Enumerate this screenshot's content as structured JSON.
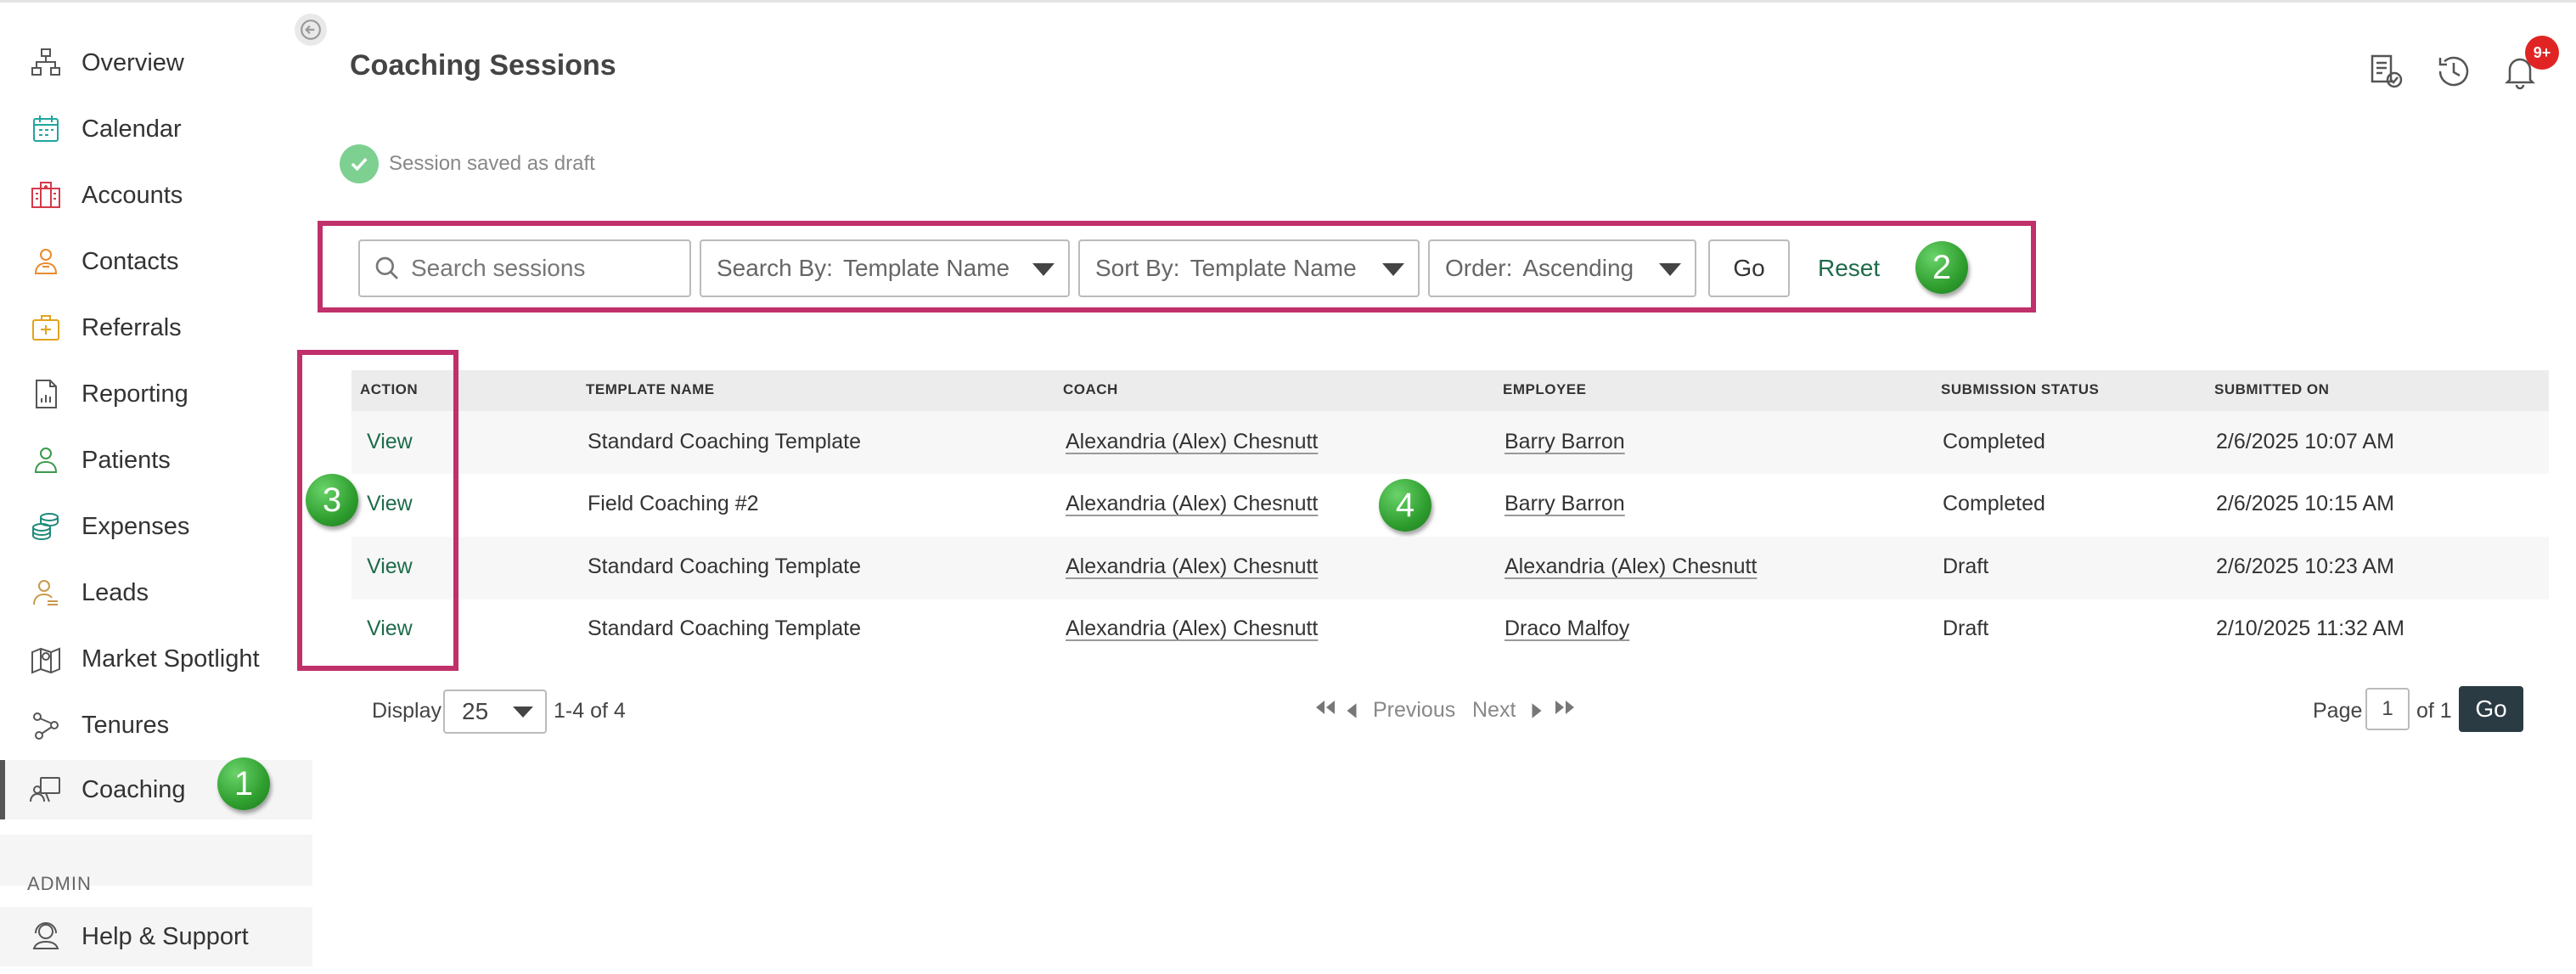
{
  "sidebar": {
    "items": [
      {
        "label": "Overview",
        "icon": "overview-icon"
      },
      {
        "label": "Calendar",
        "icon": "calendar-icon"
      },
      {
        "label": "Accounts",
        "icon": "accounts-icon"
      },
      {
        "label": "Contacts",
        "icon": "contacts-icon"
      },
      {
        "label": "Referrals",
        "icon": "referrals-icon"
      },
      {
        "label": "Reporting",
        "icon": "reporting-icon"
      },
      {
        "label": "Patients",
        "icon": "patients-icon"
      },
      {
        "label": "Expenses",
        "icon": "expenses-icon"
      },
      {
        "label": "Leads",
        "icon": "leads-icon"
      },
      {
        "label": "Market Spotlight",
        "icon": "market-spotlight-icon"
      },
      {
        "label": "Tenures",
        "icon": "tenures-icon"
      },
      {
        "label": "Coaching",
        "icon": "coaching-icon"
      }
    ],
    "admin_label": "ADMIN",
    "help": "Help & Support"
  },
  "header": {
    "title": "Coaching Sessions",
    "notification_count": "9+"
  },
  "message": {
    "text": "Session saved as draft"
  },
  "filters": {
    "search_placeholder": "Search sessions",
    "search_by_label": "Search By:",
    "search_by_value": "Template Name",
    "sort_by_label": "Sort By:",
    "sort_by_value": "Template Name",
    "order_label": "Order:",
    "order_value": "Ascending",
    "go_label": "Go",
    "reset_label": "Reset"
  },
  "callouts": [
    "1",
    "2",
    "3",
    "4"
  ],
  "table": {
    "columns": [
      "ACTION",
      "TEMPLATE NAME",
      "COACH",
      "EMPLOYEE",
      "SUBMISSION STATUS",
      "SUBMITTED ON"
    ],
    "rows": [
      {
        "action": "View",
        "template": "Standard Coaching Template",
        "coach": "Alexandria (Alex) Chesnutt",
        "employee": "Barry Barron",
        "status": "Completed",
        "submitted": "2/6/2025 10:07 AM"
      },
      {
        "action": "View",
        "template": "Field Coaching #2",
        "coach": "Alexandria (Alex) Chesnutt",
        "employee": "Barry Barron",
        "status": "Completed",
        "submitted": "2/6/2025 10:15 AM"
      },
      {
        "action": "View",
        "template": "Standard Coaching Template",
        "coach": "Alexandria (Alex) Chesnutt",
        "employee": "Alexandria (Alex) Chesnutt",
        "status": "Draft",
        "submitted": "2/6/2025 10:23 AM"
      },
      {
        "action": "View",
        "template": "Standard Coaching Template",
        "coach": "Alexandria (Alex) Chesnutt",
        "employee": "Draco Malfoy",
        "status": "Draft",
        "submitted": "2/10/2025 11:32 AM"
      }
    ]
  },
  "pagination": {
    "display_label": "Display",
    "page_size": "25",
    "range": "1-4 of 4",
    "previous": "Previous",
    "next": "Next",
    "page_label": "Page",
    "page_value": "1",
    "of_label": "of 1",
    "go_label": "Go"
  },
  "colors": {
    "accent_green": "#1e6b4a",
    "highlight": "#c0306a",
    "badge": "#e02424"
  }
}
